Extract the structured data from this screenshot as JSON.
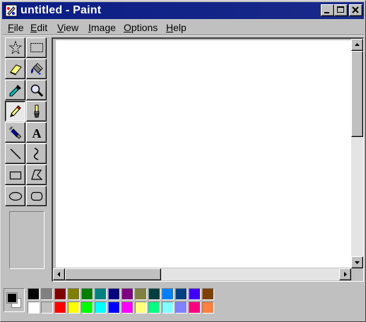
{
  "window": {
    "title": "untitled - Paint"
  },
  "menu": {
    "items": [
      {
        "label": "File",
        "mnemonic": "F"
      },
      {
        "label": "Edit",
        "mnemonic": "E"
      },
      {
        "label": "View",
        "mnemonic": "V"
      },
      {
        "label": "Image",
        "mnemonic": "I"
      },
      {
        "label": "Options",
        "mnemonic": "O"
      },
      {
        "label": "Help",
        "mnemonic": "H"
      }
    ]
  },
  "toolbox": {
    "tools": [
      {
        "name": "free-form-select",
        "icon": "star-select-icon"
      },
      {
        "name": "select",
        "icon": "rect-select-icon"
      },
      {
        "name": "eraser",
        "icon": "eraser-icon"
      },
      {
        "name": "fill-with-color",
        "icon": "paint-bucket-icon"
      },
      {
        "name": "pick-color",
        "icon": "eyedropper-icon"
      },
      {
        "name": "magnifier",
        "icon": "magnifier-icon"
      },
      {
        "name": "pencil",
        "icon": "pencil-icon",
        "active": true
      },
      {
        "name": "brush",
        "icon": "brush-icon"
      },
      {
        "name": "airbrush",
        "icon": "airbrush-icon"
      },
      {
        "name": "text",
        "icon": "text-icon",
        "glyph": "A"
      },
      {
        "name": "line",
        "icon": "line-icon"
      },
      {
        "name": "curve",
        "icon": "curve-icon"
      },
      {
        "name": "rectangle",
        "icon": "rectangle-icon"
      },
      {
        "name": "polygon",
        "icon": "polygon-icon"
      },
      {
        "name": "ellipse",
        "icon": "ellipse-icon"
      },
      {
        "name": "rounded-rectangle",
        "icon": "rounded-rectangle-icon"
      }
    ]
  },
  "colors": {
    "foreground": "#000000",
    "background": "#ffffff",
    "titlebar": "#0a1d86",
    "palette_row1": [
      "#000000",
      "#808080",
      "#800000",
      "#808000",
      "#008000",
      "#008080",
      "#000080",
      "#800080",
      "#808040",
      "#004040",
      "#0080ff",
      "#004080",
      "#4000ff",
      "#804000"
    ],
    "palette_row2": [
      "#ffffff",
      "#c0c0c0",
      "#ff0000",
      "#ffff00",
      "#00ff00",
      "#00ffff",
      "#0000ff",
      "#ff00ff",
      "#ffff80",
      "#00ff80",
      "#80ffff",
      "#8080ff",
      "#ff0080",
      "#ff8040"
    ]
  }
}
